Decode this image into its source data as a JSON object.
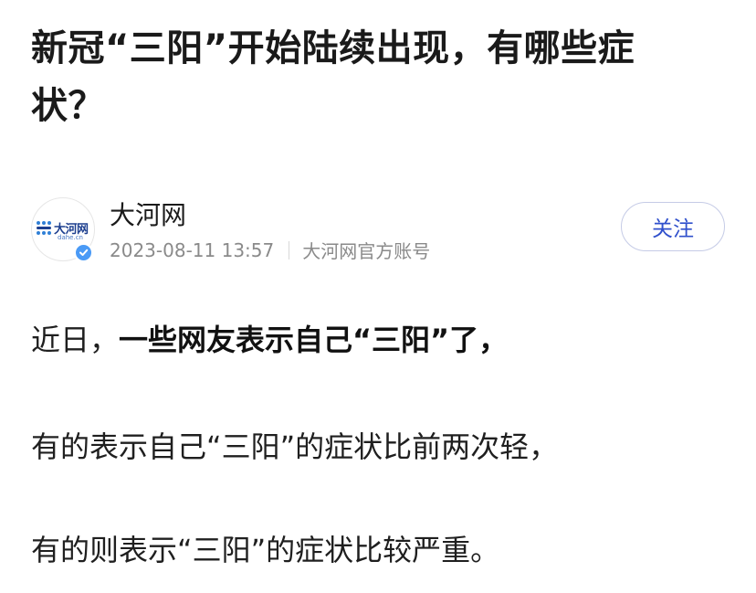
{
  "article": {
    "headline": "新冠“三阳”开始陆续出现，有哪些症状？",
    "author": {
      "name": "大河网",
      "logo_text": "大河网",
      "logo_sub": "dahe.cn",
      "verified": true,
      "verified_icon": "verified-check-icon",
      "published_at": "2023-08-11 13:57",
      "account_type": "大河网官方账号"
    },
    "follow_label": "关注",
    "paragraphs": {
      "p1_plain": "近日，",
      "p1_bold": "一些网友表示自己“三阳”了，",
      "p2": "有的表示自己“三阳”的症状比前两次轻，",
      "p3": "有的则表示“三阳”的症状比较严重。"
    }
  },
  "colors": {
    "follow_text": "#3050cc",
    "follow_border": "#c5cbe6",
    "verified_badge": "#4a9af6",
    "logo_blue": "#1d3f8f",
    "meta_gray": "#8a8a8a"
  }
}
